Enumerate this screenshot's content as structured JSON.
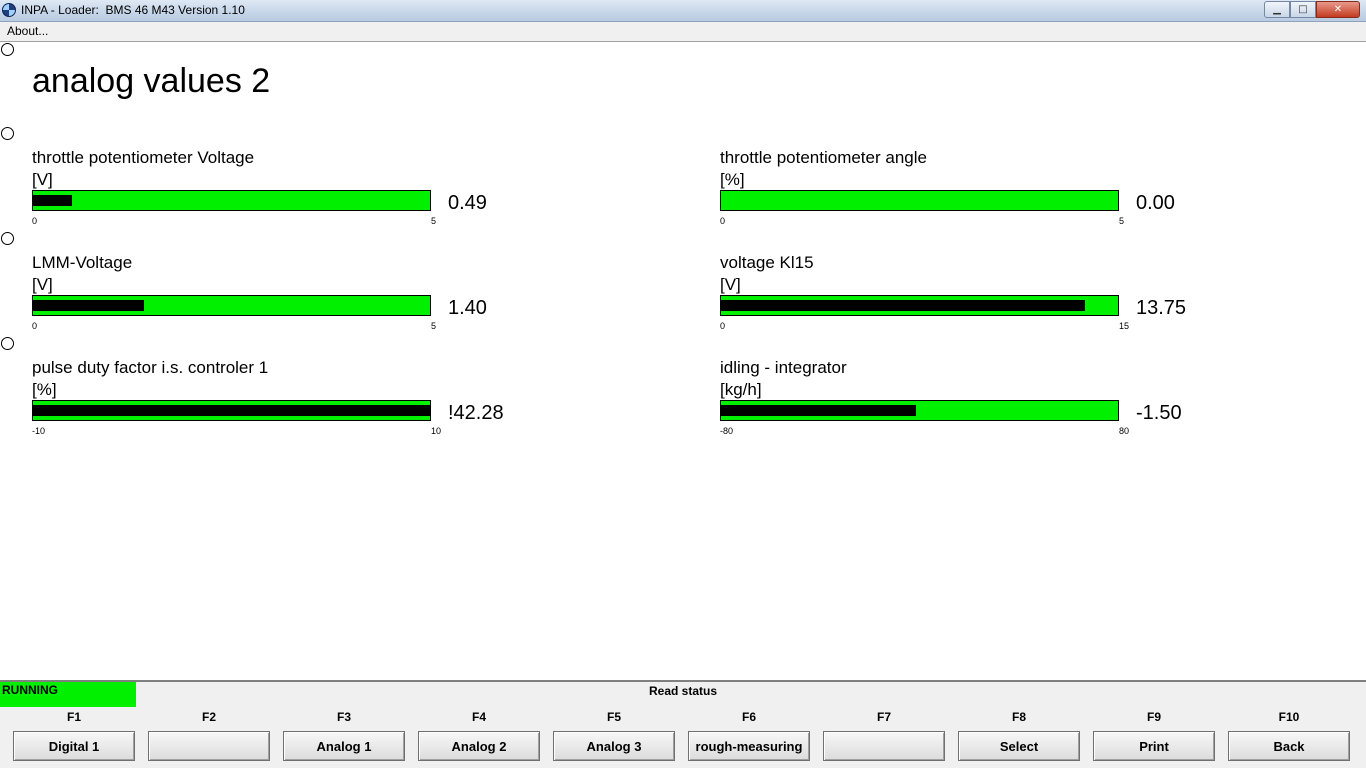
{
  "window": {
    "title": "INPA - Loader:  BMS 46 M43 Version 1.10",
    "icon": "bmw-logo-icon",
    "controls": {
      "minimize": "▁",
      "maximize": "□",
      "close": "✕"
    }
  },
  "menu": {
    "about": "About..."
  },
  "page": {
    "title": "analog values 2"
  },
  "gauges": [
    {
      "label": "throttle potentiometer Voltage",
      "unit": "[V]",
      "min": "0",
      "max": "5",
      "min_num": 0,
      "max_num": 5,
      "value": "0.49",
      "value_num": 0.49
    },
    {
      "label": "throttle potentiometer angle",
      "unit": "[%]",
      "min": "0",
      "max": "5",
      "min_num": 0,
      "max_num": 5,
      "value": "0.00",
      "value_num": 0.0
    },
    {
      "label": "LMM-Voltage",
      "unit": "[V]",
      "min": "0",
      "max": "5",
      "min_num": 0,
      "max_num": 5,
      "value": "1.40",
      "value_num": 1.4
    },
    {
      "label": "voltage Kl15",
      "unit": "[V]",
      "min": "0",
      "max": "15",
      "min_num": 0,
      "max_num": 15,
      "value": "13.75",
      "value_num": 13.75
    },
    {
      "label": "pulse duty factor i.s. controler 1",
      "unit": "[%]",
      "min": "-10",
      "max": "10",
      "min_num": -10,
      "max_num": 10,
      "value": "!42.28",
      "value_num": 42.28
    },
    {
      "label": "idling - integrator",
      "unit": "[kg/h]",
      "min": "-80",
      "max": "80",
      "min_num": -80,
      "max_num": 80,
      "value": "-1.50",
      "value_num": -1.5
    }
  ],
  "status": {
    "running": "RUNNING",
    "text": "Read status",
    "running_color": "#00f000"
  },
  "fkeys": [
    {
      "key": "F1",
      "label": "Digital 1"
    },
    {
      "key": "F2",
      "label": ""
    },
    {
      "key": "F3",
      "label": "Analog 1"
    },
    {
      "key": "F4",
      "label": "Analog 2"
    },
    {
      "key": "F5",
      "label": "Analog 3"
    },
    {
      "key": "F6",
      "label": "rough-measuring"
    },
    {
      "key": "F7",
      "label": ""
    },
    {
      "key": "F8",
      "label": "Select"
    },
    {
      "key": "F9",
      "label": "Print"
    },
    {
      "key": "F10",
      "label": "Back"
    }
  ],
  "colors": {
    "bar_fill": "#00f000",
    "bar_value": "#000000"
  }
}
